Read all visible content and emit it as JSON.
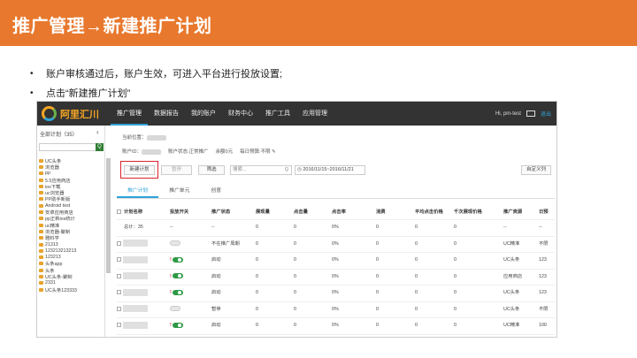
{
  "slide": {
    "title": "推广管理→新建推广计划",
    "bullets": [
      "账户审核通过后，账户生效，可进入平台进行投放设置;",
      "点击“新建推广计划”"
    ]
  },
  "app": {
    "logo_text": "阿里汇川",
    "nav": [
      "推广管理",
      "数据报告",
      "我的账户",
      "财务中心",
      "推广工具",
      "应用管理"
    ],
    "user": {
      "greeting": "Hi, pm-test",
      "exit": "退出"
    },
    "sidebar": {
      "title": "全部计划（35）",
      "items": [
        "UC头条",
        "浏览器",
        "pp",
        "5.5应用商店",
        "ios下载",
        "uc浏览器",
        "PP助手新版",
        "Android test",
        "安卓应用商店",
        "pp正新ios统计",
        "uc精准",
        "浏览器-聚制",
        "雅料学",
        "21313",
        "123213213213",
        "123213",
        "头条app",
        "头条",
        "UC头条-聚制",
        "2331",
        "UC头条123333"
      ]
    },
    "breadcrumb": "当前位置：",
    "account": {
      "id_label": "账户ID：",
      "status": "账户状态:正常推广",
      "balance": "余额0元",
      "budget": "每日预算:不限"
    },
    "toolbar": {
      "new_plan": "新建计划",
      "pause": "暂停",
      "filter": "筛选",
      "search_placeholder": "搜索...",
      "date_range": "2016/11/15~2016/11/21",
      "custom_columns": "自定义列"
    },
    "tabs": [
      "推广计划",
      "推广单元",
      "创意"
    ],
    "table": {
      "headers": [
        "计划名称",
        "投放开关",
        "推广状态",
        "展现量",
        "点击量",
        "点击率",
        "消费",
        "平均点击价格",
        "千次展现价格",
        "推广资源",
        "日预"
      ],
      "total": {
        "name": "总计：35",
        "switch": "--",
        "status": "--",
        "cells": [
          "0",
          "0",
          "0%",
          "0",
          "0",
          "0"
        ],
        "res": "--",
        "budget": "--"
      },
      "rows": [
        {
          "switch_on": false,
          "warn": false,
          "status": "不在推广周期",
          "cells": [
            "0",
            "0",
            "0%",
            "0",
            "0",
            "0"
          ],
          "res": "UC精准",
          "budget": "不限"
        },
        {
          "switch_on": true,
          "warn": true,
          "status": "启动",
          "cells": [
            "0",
            "0",
            "0%",
            "0",
            "0",
            "0"
          ],
          "res": "UC头条",
          "budget": "123"
        },
        {
          "switch_on": true,
          "warn": true,
          "status": "启动",
          "cells": [
            "0",
            "0",
            "0%",
            "0",
            "0",
            "0"
          ],
          "res": "应用商店",
          "budget": "123"
        },
        {
          "switch_on": true,
          "warn": true,
          "status": "启动",
          "cells": [
            "0",
            "0",
            "0%",
            "0",
            "0",
            "0"
          ],
          "res": "UC头条",
          "budget": "123"
        },
        {
          "switch_on": false,
          "warn": false,
          "status": "暂停",
          "cells": [
            "0",
            "0",
            "0%",
            "0",
            "0",
            "0"
          ],
          "res": "UC头条",
          "budget": "不限"
        },
        {
          "switch_on": true,
          "warn": true,
          "status": "启动",
          "cells": [
            "0",
            "0",
            "0%",
            "0",
            "0",
            "0"
          ],
          "res": "UC精准",
          "budget": "100"
        }
      ]
    }
  }
}
